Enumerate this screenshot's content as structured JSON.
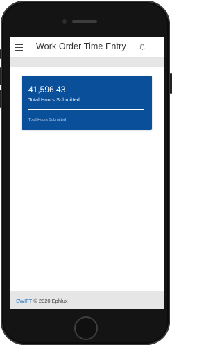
{
  "header": {
    "title": "Work Order Time Entry",
    "menu_icon": "hamburger-menu-icon",
    "bell_icon": "bell-icon"
  },
  "stat_card": {
    "value": "41,596.43",
    "label": "Total Hours Submitted",
    "caption": "Total Hours Submitted",
    "progress_fraction": 1.0,
    "color": "#0a4f9a"
  },
  "footer": {
    "brand": "SWIFT",
    "copyright": "© 2020 Ephlux",
    "brand_color": "#1f6fbf"
  }
}
